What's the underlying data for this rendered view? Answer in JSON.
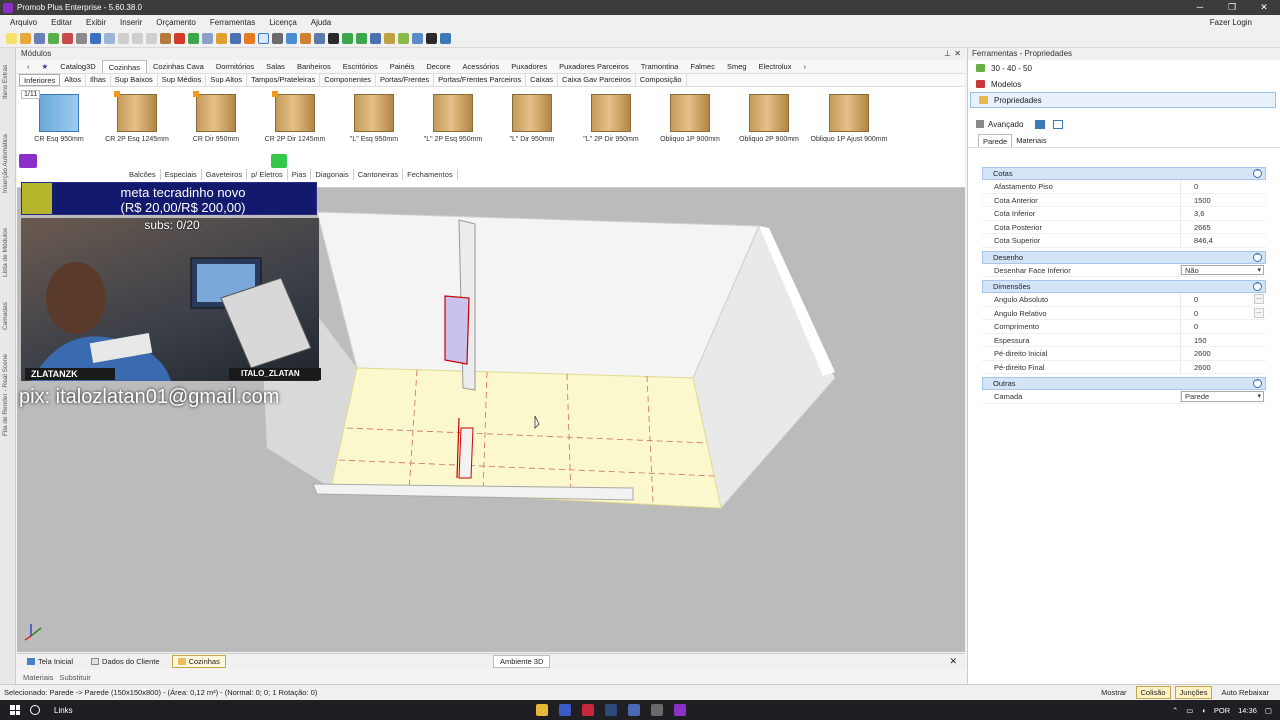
{
  "window": {
    "title": "Promob Plus Enterprise - 5.60.38.0"
  },
  "menu": {
    "items": [
      "Arquivo",
      "Editar",
      "Exibir",
      "Inserir",
      "Orçamento",
      "Ferramentas",
      "Licença",
      "Ajuda"
    ],
    "login": "Fazer Login"
  },
  "left_strip": {
    "tabs": [
      "Itens Extras",
      "Inserção Automática",
      "Lista de Módulos",
      "Camadas",
      "Fila de Render - Real Scene"
    ]
  },
  "modules": {
    "title": "Módulos",
    "top_tabs": [
      "Catalog3D",
      "Cozinhas",
      "Cozinhas Cava",
      "Dormitórios",
      "Salas",
      "Banheiros",
      "Escritórios",
      "Painéis",
      "Decore",
      "Acessórios",
      "Puxadores",
      "Puxadores Parceiros",
      "Tramontina",
      "Falmec",
      "Smeg",
      "Electrolux"
    ],
    "sub_tabs": [
      "Inferiores",
      "Altos",
      "Ilhas",
      "Sup Baixos",
      "Sup Médios",
      "Sup Altos",
      "Tampos/Prateleiras",
      "Componentes",
      "Portas/Frentes",
      "Portas/Frentes Parceiros",
      "Caixas",
      "Caixa Gav Parceiros",
      "Composição"
    ],
    "page": "1/11",
    "thumbnails": [
      "CR Esq 950mm",
      "CR 2P Esq 1245mm",
      "CR Dir 950mm",
      "CR 2P Dir 1245mm",
      "\"L\" Esq 950mm",
      "\"L\" 2P Esq 950mm",
      "\"L\" Dir 950mm",
      "\"L\" 2P Dir 950mm",
      "Obliquo 1P 900mm",
      "Obliquo 2P 900mm",
      "Obliquo 1P Ajust 900mm"
    ],
    "lower_tabs": [
      "Balcões",
      "Especiais",
      "Gaveteiros",
      "p/ Eletros",
      "Pias",
      "Diagonais",
      "Cantoneiras",
      "Fechamentos"
    ]
  },
  "stream_overlay": {
    "goal_title": "meta tecradinho novo",
    "goal_value": "(R$ 20,00/R$ 200,00)",
    "subs": "subs: 0/20",
    "name_left": "ZLATANZK",
    "name_right": "ITALO_ZLATAN",
    "pix": "pix: italozlatan01@gmail.com"
  },
  "document_tabs": {
    "tabs": [
      "Tela Inicial",
      "Dados do Cliente",
      "Cozinhas"
    ],
    "active": "Cozinhas",
    "view": "Ambiente 3D"
  },
  "bottom_tabs": [
    "Materiais",
    "Substituir"
  ],
  "status": {
    "selection": "Selecionado: Parede -> Parede (150x150x800) - (Área: 0,12 m²) - (Normal: 0; 0; 1 Rotação: 0)",
    "buttons": [
      "Mostrar",
      "Colisão",
      "Junções",
      "Auto Rebaixar"
    ]
  },
  "taskbar": {
    "search_label": "Links",
    "lang": "POR",
    "time": "14:36"
  },
  "properties": {
    "title": "Ferramentas - Propriedades",
    "nav": [
      "30 - 40 - 50",
      "Modelos",
      "Propriedades"
    ],
    "active_nav": "Propriedades",
    "advanced": "Avançado",
    "subtabs": [
      "Parede",
      "Materiais"
    ],
    "sections": [
      {
        "name": "Cotas",
        "rows": [
          {
            "k": "Afastamento Piso",
            "v": "0"
          },
          {
            "k": "Cota Anterior",
            "v": "1500"
          },
          {
            "k": "Cota Inferior",
            "v": "3,6"
          },
          {
            "k": "Cota Posterior",
            "v": "2665"
          },
          {
            "k": "Cota Superior",
            "v": "846,4"
          }
        ]
      },
      {
        "name": "Desenho",
        "rows": [
          {
            "k": "Desenhar Face Inferior",
            "v": "Não",
            "select": true
          }
        ]
      },
      {
        "name": "Dimensões",
        "rows": [
          {
            "k": "Angulo Absoluto",
            "v": "0"
          },
          {
            "k": "Angulo Relativo",
            "v": "0"
          },
          {
            "k": "Comprimento",
            "v": "0"
          },
          {
            "k": "Espessura",
            "v": "150"
          },
          {
            "k": "Pé-direito Inicial",
            "v": "2600"
          },
          {
            "k": "Pé-direito Final",
            "v": "2600"
          }
        ]
      },
      {
        "name": "Outras",
        "rows": [
          {
            "k": "Camada",
            "v": "Parede",
            "select": true
          }
        ]
      }
    ]
  },
  "colors": {
    "accent": "#3a79b8",
    "section": "#d4e4f7",
    "floor": "#fbf8cd",
    "selection": "#cc0000"
  }
}
